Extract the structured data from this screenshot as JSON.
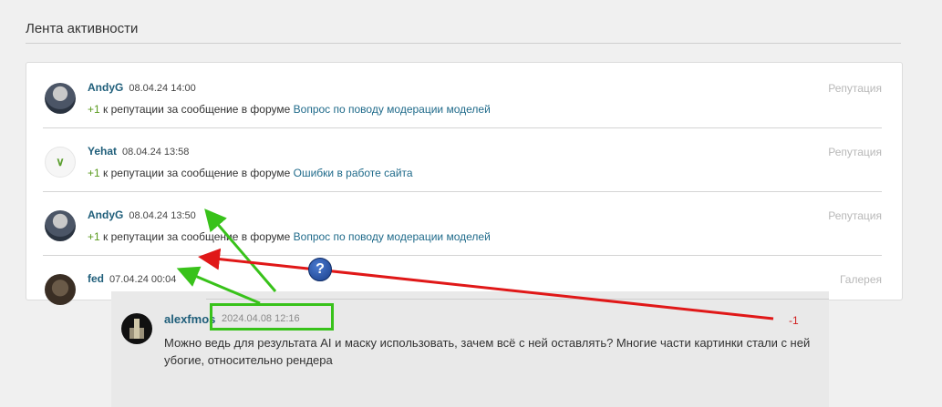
{
  "page": {
    "title": "Лента активности"
  },
  "feed": {
    "items": [
      {
        "user": "AndyG",
        "date": "08.04.24 14:00",
        "category": "Репутация",
        "plus": "+1",
        "text": " к репутации за сообщение в форуме ",
        "topic": "Вопрос по поводу модерации моделей"
      },
      {
        "user": "Yehat",
        "date": "08.04.24 13:58",
        "category": "Репутация",
        "plus": "+1",
        "text": " к репутации за сообщение в форуме ",
        "topic": "Ошибки в работе сайта"
      },
      {
        "user": "AndyG",
        "date": "08.04.24 13:50",
        "category": "Репутация",
        "plus": "+1",
        "text": " к репутации за сообщение в форуме ",
        "topic": "Вопрос по поводу модерации моделей"
      },
      {
        "user": "fed",
        "date": "07.04.24 00:04",
        "category": "Галерея"
      }
    ]
  },
  "comment": {
    "user": "alexfmos",
    "date": "2024.04.08 12:16",
    "score": "-1",
    "text": "Можно ведь для результата AI и маску использовать, зачем всё с ней оставлять? Многие части картинки стали с ней убогие, относительно рендера"
  },
  "annotations": {
    "help_glyph": "?",
    "colors": {
      "green": "#38c21a",
      "red": "#e01818",
      "help": "#1a3f8a"
    }
  }
}
